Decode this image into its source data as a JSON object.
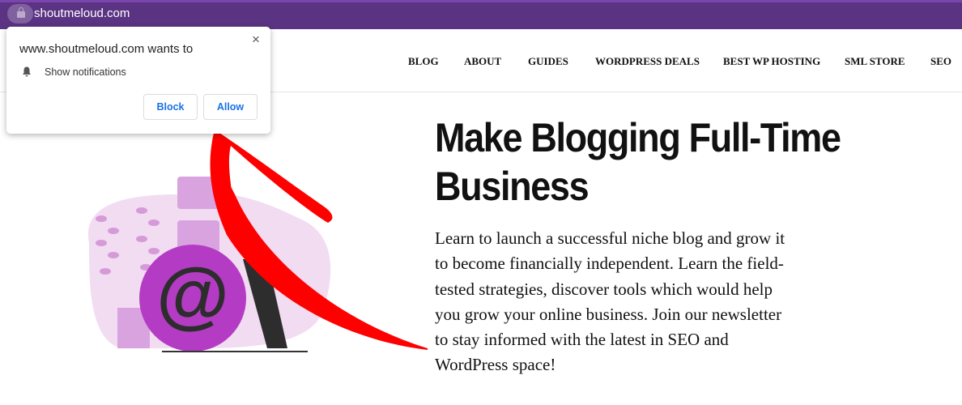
{
  "browser": {
    "url": "shoutmeloud.com",
    "lock_icon": "lock-icon"
  },
  "nav": [
    "BLOG",
    "ABOUT",
    "GUIDES",
    "WORDPRESS DEALS",
    "BEST WP HOSTING",
    "SML STORE",
    "SEO"
  ],
  "popup": {
    "title": "www.shoutmeloud.com wants to",
    "permission": "Show notifications",
    "block": "Block",
    "allow": "Allow",
    "close": "×"
  },
  "hero": {
    "title": "Make Blogging Full-Time Business",
    "body": "Learn to launch a successful niche blog and grow it to become financially independent. Learn the field-tested strategies, discover tools which would help you grow your online business. Join our newsletter to stay informed with the latest in SEO and WordPress space!"
  },
  "colors": {
    "browser_bar": "#5b3383",
    "accent_purple": "#b43cc4",
    "arrow": "#ff0000",
    "button_text": "#1a73e8"
  }
}
